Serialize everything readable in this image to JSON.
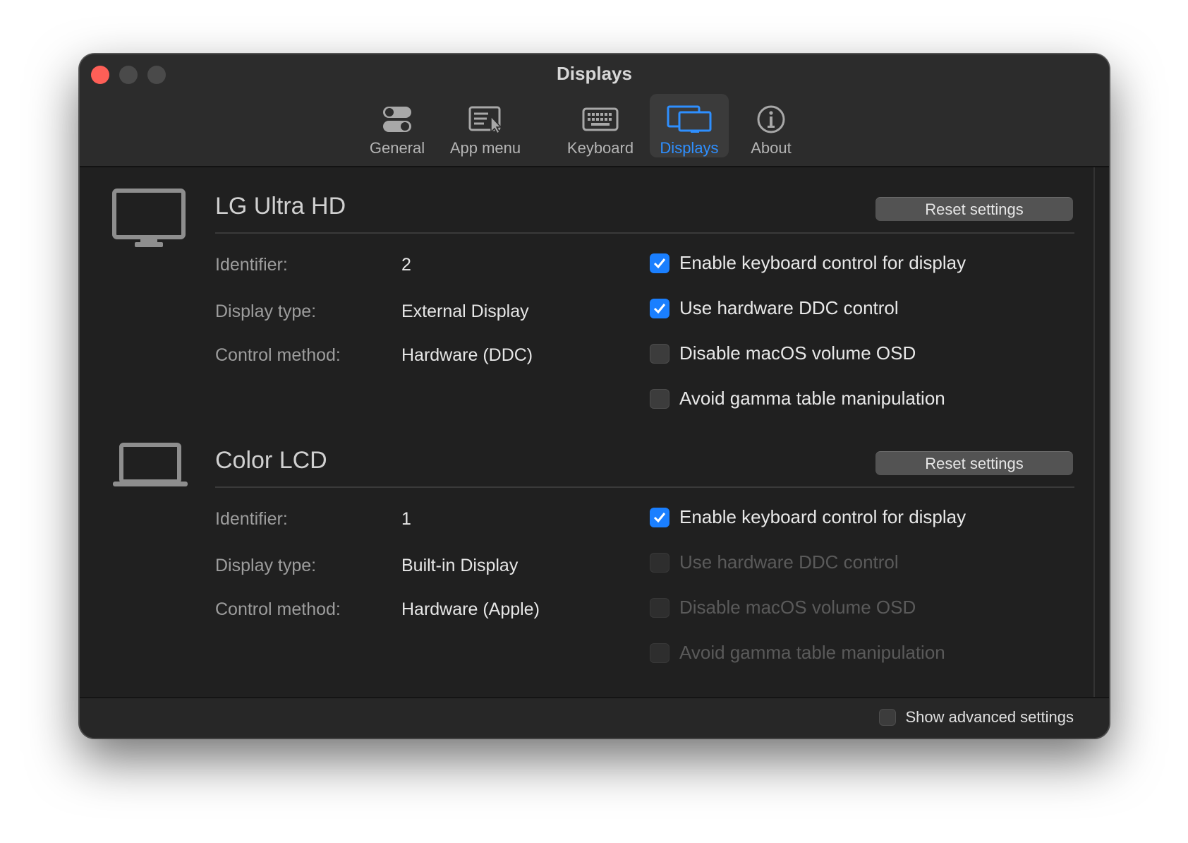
{
  "window": {
    "title": "Displays",
    "controls": [
      "close",
      "minimize",
      "maximize"
    ]
  },
  "toolbar": {
    "tabs": [
      {
        "label": "General",
        "icon": "toggle-switches-icon",
        "active": false
      },
      {
        "label": "App menu",
        "icon": "menu-pointer-icon",
        "active": false
      },
      {
        "label": "Keyboard",
        "icon": "keyboard-icon",
        "active": false
      },
      {
        "label": "Displays",
        "icon": "displays-icon",
        "active": true
      },
      {
        "label": "About",
        "icon": "info-icon",
        "active": false
      }
    ]
  },
  "colors": {
    "accent": "#2e8fff",
    "checkbox_on": "#1a7fff",
    "close": "#fe5f57",
    "background": "#202020"
  },
  "displays": [
    {
      "name": "LG Ultra HD",
      "icon": "monitor-icon",
      "reset_label": "Reset settings",
      "fields": [
        {
          "key": "Identifier:",
          "value": "2"
        },
        {
          "key": "Display type:",
          "value": "External Display"
        },
        {
          "key": "Control method:",
          "value": "Hardware (DDC)"
        }
      ],
      "options": [
        {
          "label": "Enable keyboard control for display",
          "checked": true,
          "enabled": true
        },
        {
          "label": "Use hardware DDC control",
          "checked": true,
          "enabled": true
        },
        {
          "label": "Disable macOS volume OSD",
          "checked": false,
          "enabled": true
        },
        {
          "label": "Avoid gamma table manipulation",
          "checked": false,
          "enabled": true
        }
      ]
    },
    {
      "name": "Color LCD",
      "icon": "laptop-icon",
      "reset_label": "Reset settings",
      "fields": [
        {
          "key": "Identifier:",
          "value": "1"
        },
        {
          "key": "Display type:",
          "value": "Built-in Display"
        },
        {
          "key": "Control method:",
          "value": "Hardware (Apple)"
        }
      ],
      "options": [
        {
          "label": "Enable keyboard control for display",
          "checked": true,
          "enabled": true
        },
        {
          "label": "Use hardware DDC control",
          "checked": false,
          "enabled": false
        },
        {
          "label": "Disable macOS volume OSD",
          "checked": false,
          "enabled": false
        },
        {
          "label": "Avoid gamma table manipulation",
          "checked": false,
          "enabled": false
        }
      ]
    }
  ],
  "footer": {
    "advanced_label": "Show advanced settings",
    "advanced_checked": false
  }
}
